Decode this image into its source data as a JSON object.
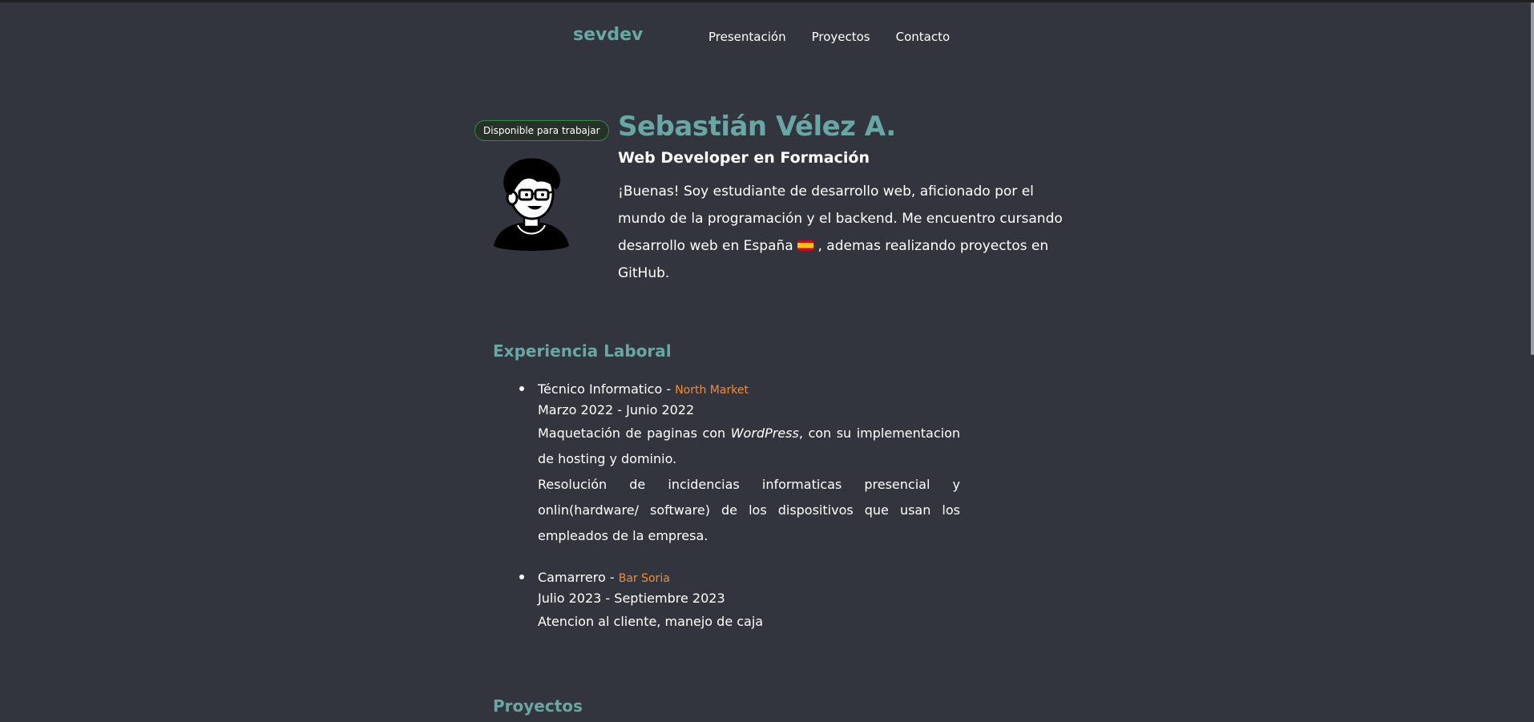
{
  "header": {
    "brand": "sevdev",
    "nav": [
      "Presentación",
      "Proyectos",
      "Contacto"
    ]
  },
  "hero": {
    "badge": "Disponible para trabajar",
    "name": "Sebastián Vélez A.",
    "subtitle": "Web Developer en Formación",
    "bio_part1": "¡Buenas! Soy estudiante de desarrollo web, aficionado por el mundo de la programación y el backend. Me encuentro cursando desarrollo web en España",
    "bio_part2": ", ademas realizando proyectos en GitHub."
  },
  "experience": {
    "title": "Experiencia Laboral",
    "jobs": [
      {
        "role": "Técnico Informatico",
        "separator": "-",
        "company": "North Market",
        "dates": "Marzo 2022 - Junio 2022",
        "desc1_a": "Maquetación de paginas con",
        "desc1_em": "WordPress",
        "desc1_b": ", con su implementacion de hosting y dominio.",
        "desc2": "Resolución de incidencias informaticas presencial y onlin(hardware/ software) de los dispositivos que usan los empleados de la empresa."
      },
      {
        "role": "Camarrero",
        "separator": "-",
        "company": "Bar Soria",
        "dates": "Julio 2023 - Septiembre 2023",
        "desc1": "Atencion al cliente, manejo de caja"
      }
    ]
  },
  "projects": {
    "title": "Proyectos"
  },
  "colors": {
    "background": "#32353d",
    "accent": "#69a7a4",
    "company": "#f28c38",
    "badge_border": "#2e8b3c"
  },
  "icons": [
    "avatar-illustration",
    "spain-flag-icon"
  ]
}
